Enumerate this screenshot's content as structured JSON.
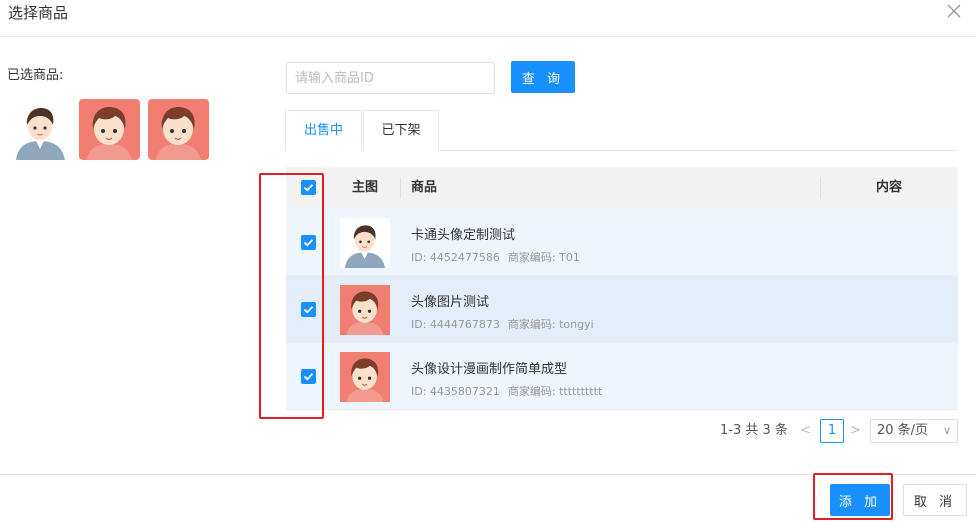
{
  "dialog": {
    "title": "选择商品"
  },
  "selected": {
    "label": "已选商品:",
    "thumbs": [
      "boy-avatar",
      "girl-avatar",
      "girl-avatar"
    ]
  },
  "search": {
    "placeholder": "请输入商品ID",
    "button_label": "查 询"
  },
  "tabs": [
    {
      "label": "出售中",
      "active": true
    },
    {
      "label": "已下架",
      "active": false
    }
  ],
  "table": {
    "headers": {
      "image": "主图",
      "product": "商品",
      "content": "内容"
    },
    "rows": [
      {
        "name": "卡通头像定制测试",
        "id": "ID: 4452477586",
        "merchant_code": "商家编码: T01",
        "image": "boy-avatar",
        "checked": true
      },
      {
        "name": "头像图片测试",
        "id": "ID: 4444767873",
        "merchant_code": "商家编码: tongyi",
        "image": "girl-avatar",
        "checked": true
      },
      {
        "name": "头像设计漫画制作简单成型",
        "id": "ID: 4435807321",
        "merchant_code": "商家编码: tttttttttt",
        "image": "girl-avatar",
        "checked": true
      }
    ]
  },
  "pagination": {
    "total_text": "1-3 共 3 条",
    "current_page": "1",
    "page_size": "20 条/页",
    "prev": "<",
    "next": ">"
  },
  "footer": {
    "add_label": "添 加",
    "cancel_label": "取 消"
  },
  "colors": {
    "primary": "#1890ff",
    "highlight": "#e02020"
  }
}
